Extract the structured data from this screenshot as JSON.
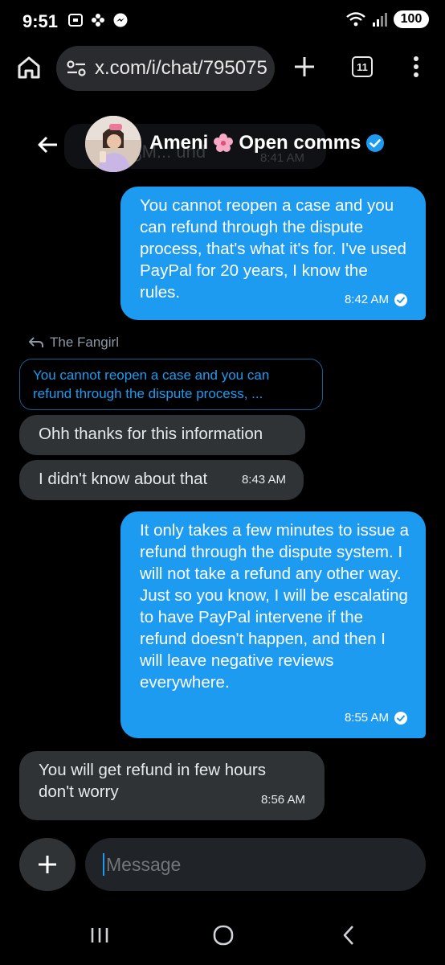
{
  "status_bar": {
    "time": "9:51",
    "battery": "100"
  },
  "browser": {
    "url": "x.com/i/chat/795075",
    "tab_count": "11"
  },
  "chat": {
    "contact_name": "Ameni",
    "contact_suffix": "Open comms",
    "ghost_text": "ɮM... und",
    "ghost_time": "8:41 AM",
    "messages": [
      {
        "direction": "sent",
        "text": "You cannot reopen a case and you can refund through the dispute process, that's what it's for.  I've used PayPal for 20 years, I know the rules.",
        "time": "8:42 AM"
      },
      {
        "direction": "recv",
        "reply_to_label": "The Fangirl",
        "quote": "You cannot reopen a case and you can refund through the dispute process, ...",
        "text": "Ohh thanks for this information"
      },
      {
        "direction": "recv",
        "text": "I didn't know about that",
        "time": "8:43 AM"
      },
      {
        "direction": "sent",
        "text": "It only takes a few minutes to issue a refund through the dispute system.  I will not take a refund any other way.  Just so you know, I will be escalating to have PayPal intervene if the refund doesn't happen, and then I will leave negative reviews everywhere.",
        "time": "8:55 AM"
      },
      {
        "direction": "recv",
        "text": "You will get refund in few hours don't worry",
        "time": "8:56 AM"
      }
    ]
  },
  "composer": {
    "placeholder": "Message"
  },
  "icons": {
    "back": "arrow-left-icon",
    "verified": "verified-badge-icon",
    "flower": "cherry-blossom-icon",
    "add": "plus-icon",
    "reply": "reply-arrow-icon",
    "check": "check-circle-icon"
  },
  "colors": {
    "accent": "#1d9bf0",
    "received_bubble": "#2f3336",
    "background": "#000000"
  }
}
